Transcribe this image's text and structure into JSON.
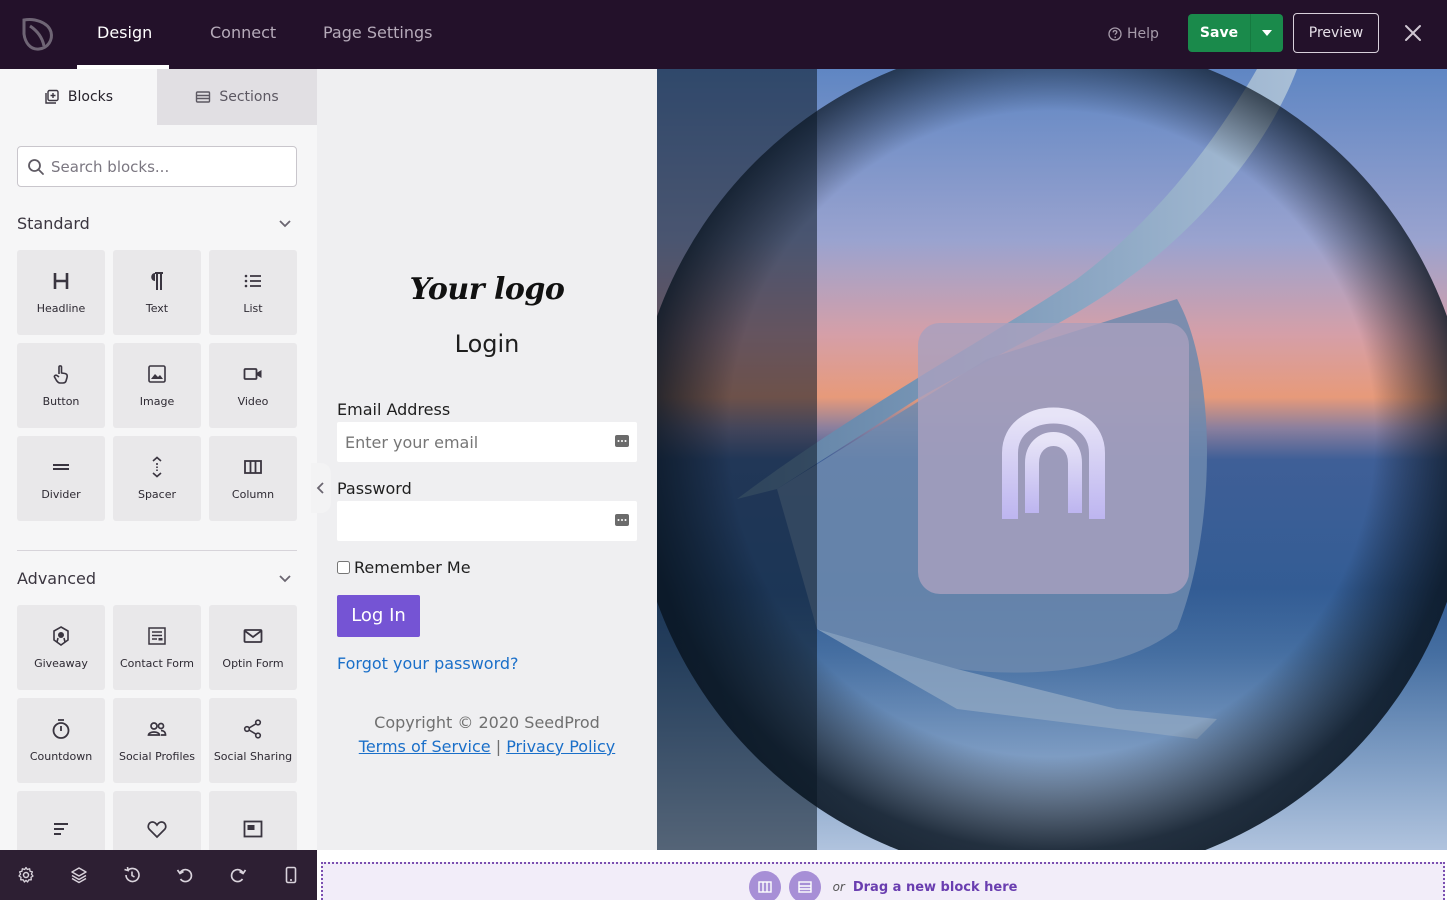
{
  "topbar": {
    "tabs": [
      {
        "label": "Design"
      },
      {
        "label": "Connect"
      },
      {
        "label": "Page Settings"
      }
    ],
    "active_tab": "Design",
    "help_label": "Help",
    "save_label": "Save",
    "preview_label": "Preview"
  },
  "sidebar": {
    "tabs": {
      "blocks": "Blocks",
      "sections": "Sections"
    },
    "search": {
      "placeholder": "Search blocks...",
      "value": ""
    },
    "groups": [
      {
        "title": "Standard",
        "blocks": [
          {
            "label": "Headline",
            "icon": "headline-icon"
          },
          {
            "label": "Text",
            "icon": "pilcrow-icon"
          },
          {
            "label": "List",
            "icon": "list-icon"
          },
          {
            "label": "Button",
            "icon": "pointer-hand-icon"
          },
          {
            "label": "Image",
            "icon": "image-icon"
          },
          {
            "label": "Video",
            "icon": "video-camera-icon"
          },
          {
            "label": "Divider",
            "icon": "divider-icon"
          },
          {
            "label": "Spacer",
            "icon": "spacer-icon"
          },
          {
            "label": "Column",
            "icon": "columns-icon"
          }
        ]
      },
      {
        "title": "Advanced",
        "blocks": [
          {
            "label": "Giveaway",
            "icon": "giveaway-icon"
          },
          {
            "label": "Contact Form",
            "icon": "contact-form-icon"
          },
          {
            "label": "Optin Form",
            "icon": "envelope-icon"
          },
          {
            "label": "Countdown",
            "icon": "stopwatch-icon"
          },
          {
            "label": "Social Profiles",
            "icon": "users-icon"
          },
          {
            "label": "Social Sharing",
            "icon": "share-icon"
          },
          {
            "label": "",
            "icon": "align-left-icon"
          },
          {
            "label": "",
            "icon": "heart-icon"
          },
          {
            "label": "",
            "icon": "window-icon"
          }
        ]
      }
    ]
  },
  "toolbar_icons": [
    "gear-icon",
    "layers-icon",
    "history-icon",
    "undo-icon",
    "redo-icon",
    "mobile-icon"
  ],
  "login_page": {
    "logo_text": "Your logo",
    "title": "Login",
    "email_label": "Email Address",
    "email_placeholder": "Enter your email",
    "email_value": "",
    "password_label": "Password",
    "password_value": "",
    "remember_label": "Remember Me",
    "remember_checked": false,
    "login_button": "Log In",
    "forgot_link": "Forgot your password?",
    "copyright": "Copyright © 2020 SeedProd",
    "terms_link": "Terms of Service",
    "separator": "|",
    "privacy_link": "Privacy Policy"
  },
  "dropzone": {
    "or_text": "or",
    "text": "Drag a new block here"
  },
  "colors": {
    "topbar_bg": "#23112a",
    "save_green": "#1a8a4b",
    "login_button": "#7554d4",
    "link_blue": "#1a6fc9"
  }
}
